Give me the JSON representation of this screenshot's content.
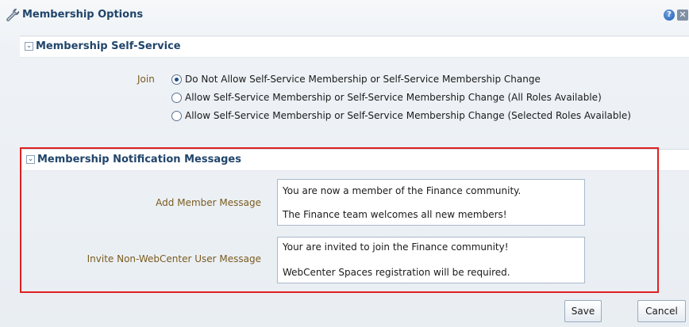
{
  "dialog": {
    "title": "Membership Options",
    "help_icon_glyph": "?",
    "close_icon_glyph": "✕"
  },
  "self_service": {
    "title": "Membership Self-Service",
    "join_label": "Join",
    "options": [
      {
        "label": "Do Not Allow Self-Service Membership or Self-Service Membership Change",
        "selected": true
      },
      {
        "label": "Allow Self-Service Membership or Self-Service Membership Change (All Roles Available)",
        "selected": false
      },
      {
        "label": "Allow Self-Service Membership or Self-Service Membership Change (Selected Roles Available)",
        "selected": false
      }
    ]
  },
  "notifications": {
    "title": "Membership Notification Messages",
    "add_member": {
      "label": "Add Member Message",
      "line1": "You are now a member of the Finance community.",
      "line2": "The Finance team welcomes all new members!"
    },
    "invite": {
      "label": "Invite Non-WebCenter User Message",
      "line1": "Your are invited to join the Finance community!",
      "line2": "WebCenter Spaces registration will be required."
    }
  },
  "buttons": {
    "save": "Save",
    "cancel": "Cancel"
  },
  "colors": {
    "highlight_border": "#e02020",
    "header_text": "#21456b",
    "label_text": "#7a5b1e"
  },
  "icons": {
    "title": "wrench-icon",
    "help": "help-icon",
    "close": "close-icon",
    "disclosure": "chevron-down-icon"
  }
}
